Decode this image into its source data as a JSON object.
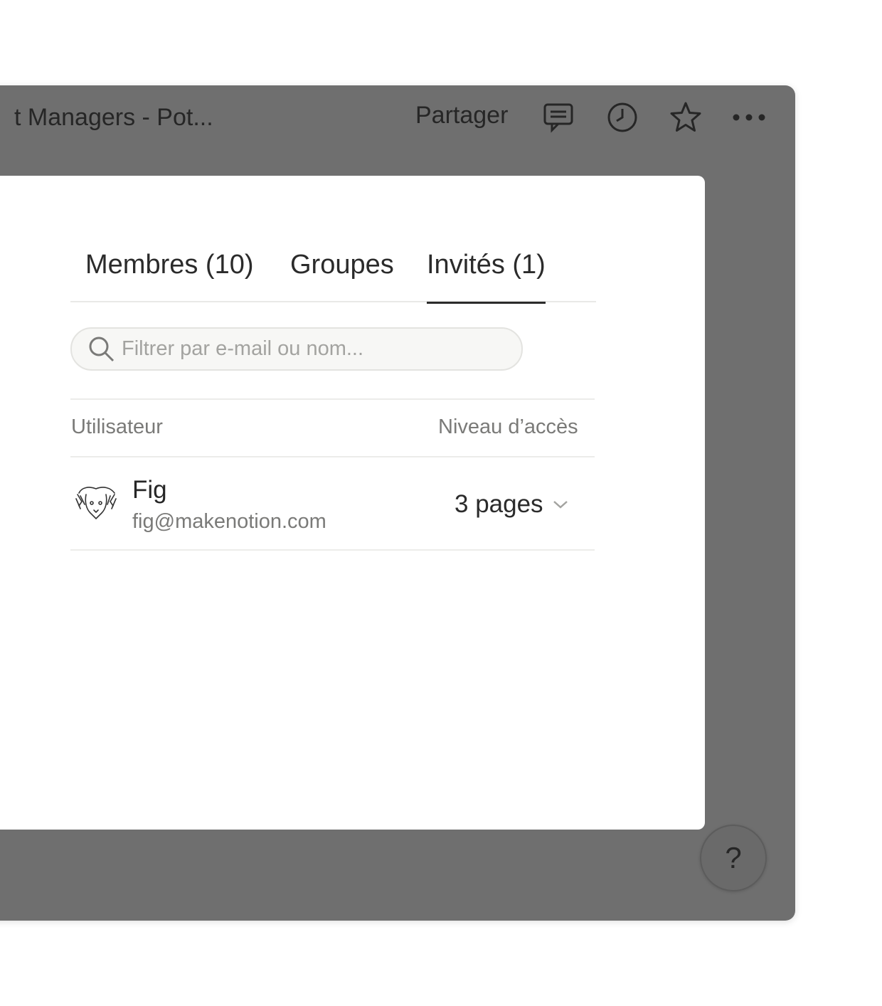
{
  "topbar": {
    "title": "t Managers - Pot...",
    "share_label": "Partager",
    "icons": [
      "comment-icon",
      "history-icon",
      "favorite-star-icon",
      "more-icon"
    ]
  },
  "modal": {
    "tabs": [
      {
        "label": "Membres (10)",
        "active": false
      },
      {
        "label": "Groupes",
        "active": false
      },
      {
        "label": "Invités (1)",
        "active": true
      }
    ],
    "search": {
      "placeholder": "Filtrer par e-mail ou nom...",
      "value": ""
    },
    "table": {
      "columns": [
        "Utilisateur",
        "Niveau d’accès"
      ],
      "rows": [
        {
          "name": "Fig",
          "email": "fig@makenotion.com",
          "access": "3 pages"
        }
      ]
    }
  },
  "help_button": {
    "label": "?"
  },
  "colors": {
    "overlay": "#6f6f6f",
    "modal_bg": "#ffffff",
    "text_primary": "#2b2b2b",
    "text_secondary": "#7a7a78",
    "divider": "#ececea"
  }
}
